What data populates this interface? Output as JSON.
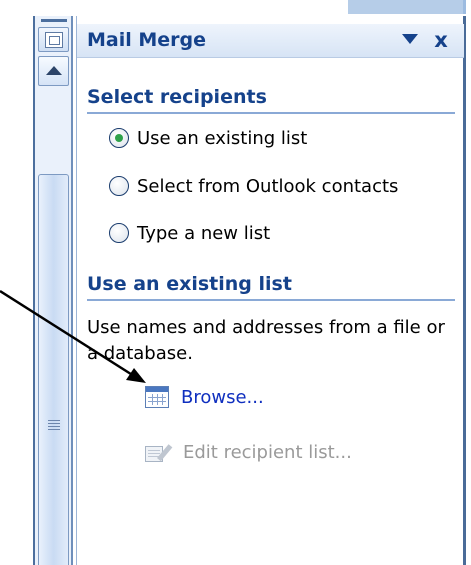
{
  "pane": {
    "title": "Mail Merge",
    "dropdown_icon": "triangle-down-icon",
    "close_label": "x"
  },
  "select_recipients": {
    "heading": "Select recipients",
    "options": [
      {
        "label": "Use an existing list",
        "checked": true
      },
      {
        "label": "Select from Outlook contacts",
        "checked": false
      },
      {
        "label": "Type a new list",
        "checked": false
      }
    ]
  },
  "existing_list": {
    "heading": "Use an existing list",
    "description": "Use names and addresses from a file or a database.",
    "browse_label": "Browse...",
    "edit_label": "Edit recipient list..."
  },
  "colors": {
    "title": "#15428b",
    "link": "#0f2fbf",
    "disabled": "#9a9a9a",
    "radio_check": "#2ea14a"
  }
}
